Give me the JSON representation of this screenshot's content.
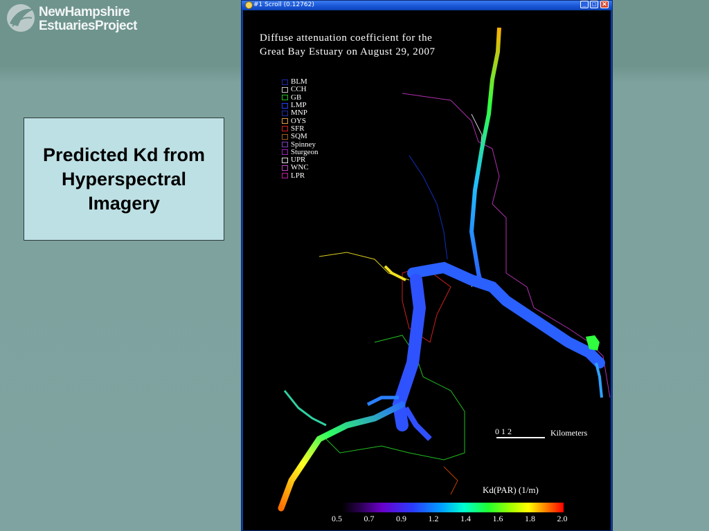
{
  "logo": {
    "line1": "NewHampshire",
    "line2": "EstuariesProject"
  },
  "caption": "Predicted Kd from Hyperspectral Imagery",
  "window": {
    "title": "#1 Scroll (0.12762)",
    "minimize": "_",
    "maximize": "□",
    "close": "✕"
  },
  "map": {
    "title_line1": "Diffuse attenuation coefficient for the",
    "title_line2": "Great Bay Estuary on August 29, 2007",
    "legend": [
      {
        "label": "BLM",
        "color": "#1a2ab0"
      },
      {
        "label": "CCH",
        "color": "#c8c8c8"
      },
      {
        "label": "GB",
        "color": "#20c020"
      },
      {
        "label": "LMP",
        "color": "#2040ff"
      },
      {
        "label": "MNP",
        "color": "#2030a0"
      },
      {
        "label": "OYS",
        "color": "#e0a040"
      },
      {
        "label": "SFR",
        "color": "#d02020"
      },
      {
        "label": "SQM",
        "color": "#a06020"
      },
      {
        "label": "Spinney",
        "color": "#8040c0"
      },
      {
        "label": "Sturgeon",
        "color": "#a020c0"
      },
      {
        "label": "UPR",
        "color": "#e0e0e0"
      },
      {
        "label": "WNC",
        "color": "#c040c0"
      },
      {
        "label": "LPR",
        "color": "#c020a0"
      }
    ],
    "scale": {
      "ticks": "0    1    2",
      "unit": "Kilometers"
    },
    "colorbar": {
      "title": "Kd(PAR) (1/m)",
      "labels": [
        "0.5",
        "0.7",
        "0.9",
        "1.2",
        "1.4",
        "1.6",
        "1.8",
        "2.0"
      ]
    }
  }
}
